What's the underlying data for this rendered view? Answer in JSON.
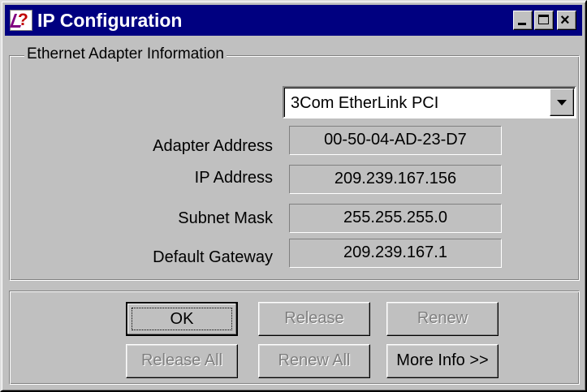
{
  "window": {
    "title": "IP Configuration",
    "controls": {
      "minimize": "minimize",
      "maximize": "maximize",
      "close": "close"
    }
  },
  "adapter_group": {
    "legend": "Ethernet  Adapter Information",
    "selected_adapter": "3Com EtherLink PCI",
    "fields": [
      {
        "label": "Adapter Address",
        "value": "00-50-04-AD-23-D7"
      },
      {
        "label": "IP Address",
        "value": "209.239.167.156"
      },
      {
        "label": "Subnet Mask",
        "value": "255.255.255.0"
      },
      {
        "label": "Default Gateway",
        "value": "209.239.167.1"
      }
    ]
  },
  "buttons": {
    "ok": "OK",
    "release": "Release",
    "renew": "Renew",
    "release_all": "Release All",
    "renew_all": "Renew All",
    "more_info": "More Info >>"
  },
  "colors": {
    "face": "#c0c0c0",
    "title_bar": "#000080",
    "disabled_text": "#808080"
  },
  "icons": {
    "app": "ip-config-icon",
    "dropdown": "chevron-down-icon"
  }
}
